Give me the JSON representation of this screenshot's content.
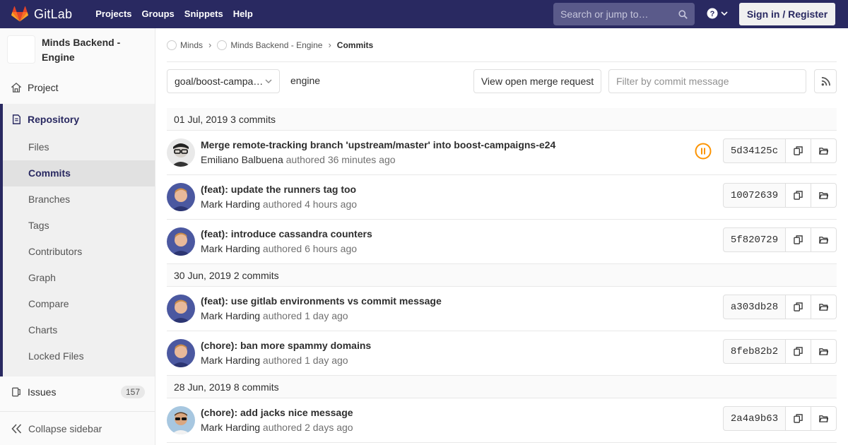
{
  "navbar": {
    "brand": "GitLab",
    "links": [
      "Projects",
      "Groups",
      "Snippets",
      "Help"
    ],
    "search_placeholder": "Search or jump to…",
    "help_icon": "question-circle-icon",
    "sign_in": "Sign in / Register",
    "brand_color": "#292961"
  },
  "sidebar": {
    "project_name": "Minds Backend - Engine",
    "project_item": "Project",
    "repository_label": "Repository",
    "repository_items": [
      "Files",
      "Commits",
      "Branches",
      "Tags",
      "Contributors",
      "Graph",
      "Compare",
      "Charts",
      "Locked Files"
    ],
    "active_item": "Commits",
    "issues_label": "Issues",
    "issues_count": "157",
    "collapse_label": "Collapse sidebar"
  },
  "breadcrumb": {
    "items": [
      "Minds",
      "Minds Backend - Engine",
      "Commits"
    ]
  },
  "toolbar": {
    "branch": "goal/boost-campaigns-e24",
    "path": "engine",
    "merge_request_button": "View open merge request",
    "filter_placeholder": "Filter by commit message",
    "rss_icon": "rss-icon"
  },
  "days": [
    {
      "header": "01 Jul, 2019 3 commits",
      "commits": [
        {
          "title": "Merge remote-tracking branch 'upstream/master' into boost-campaigns-e24",
          "author": "Emiliano Balbuena",
          "verb": "authored",
          "time": "36 minutes ago",
          "sha": "5d34125c",
          "pipeline": "paused",
          "avatar": "glasses"
        },
        {
          "title": "(feat): update the runners tag too",
          "author": "Mark Harding",
          "verb": "authored",
          "time": "4 hours ago",
          "sha": "10072639",
          "avatar": "mark"
        },
        {
          "title": "(feat): introduce cassandra counters",
          "author": "Mark Harding",
          "verb": "authored",
          "time": "6 hours ago",
          "sha": "5f820729",
          "avatar": "mark"
        }
      ]
    },
    {
      "header": "30 Jun, 2019 2 commits",
      "commits": [
        {
          "title": "(feat): use gitlab environments vs commit message",
          "author": "Mark Harding",
          "verb": "authored",
          "time": "1 day ago",
          "sha": "a303db28",
          "avatar": "mark"
        },
        {
          "title": "(chore): ban more spammy domains",
          "author": "Mark Harding",
          "verb": "authored",
          "time": "1 day ago",
          "sha": "8feb82b2",
          "avatar": "mark"
        }
      ]
    },
    {
      "header": "28 Jun, 2019 8 commits",
      "commits": [
        {
          "title": "(chore): add jacks nice message",
          "author": "Mark Harding",
          "verb": "authored",
          "time": "2 days ago",
          "sha": "2a4a9b63",
          "avatar": "sunglasses"
        }
      ]
    }
  ]
}
